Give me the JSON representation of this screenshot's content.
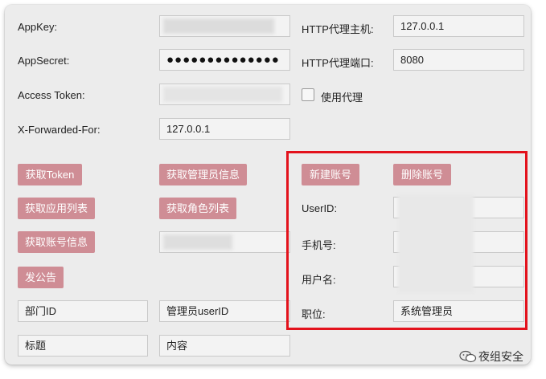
{
  "left_form": {
    "appkey_label": "AppKey:",
    "appsecret_label": "AppSecret:",
    "appsecret_value": "●●●●●●●●●●●●●●",
    "access_token_label": "Access Token:",
    "xff_label": "X-Forwarded-For:",
    "xff_value": "127.0.0.1"
  },
  "proxy": {
    "host_label": "HTTP代理主机:",
    "host_value": "127.0.0.1",
    "port_label": "HTTP代理端口:",
    "port_value": "8080",
    "use_proxy_label": "使用代理"
  },
  "buttons": {
    "get_token": "获取Token",
    "get_admin_info": "获取管理员信息",
    "get_app_list": "获取应用列表",
    "get_role_list": "获取角色列表",
    "get_account_info": "获取账号信息",
    "announce": "发公告",
    "new_account": "新建账号",
    "delete_account": "删除账号"
  },
  "announce_form": {
    "dept_placeholder": "部门ID",
    "admin_userid_placeholder": "管理员userID",
    "title_placeholder": "标题",
    "content_placeholder": "内容"
  },
  "account_form": {
    "userid_label": "UserID:",
    "mobile_label": "手机号:",
    "username_label": "用户名:",
    "position_label": "职位:",
    "position_value": "系统管理员"
  },
  "watermark": "夜组安全"
}
